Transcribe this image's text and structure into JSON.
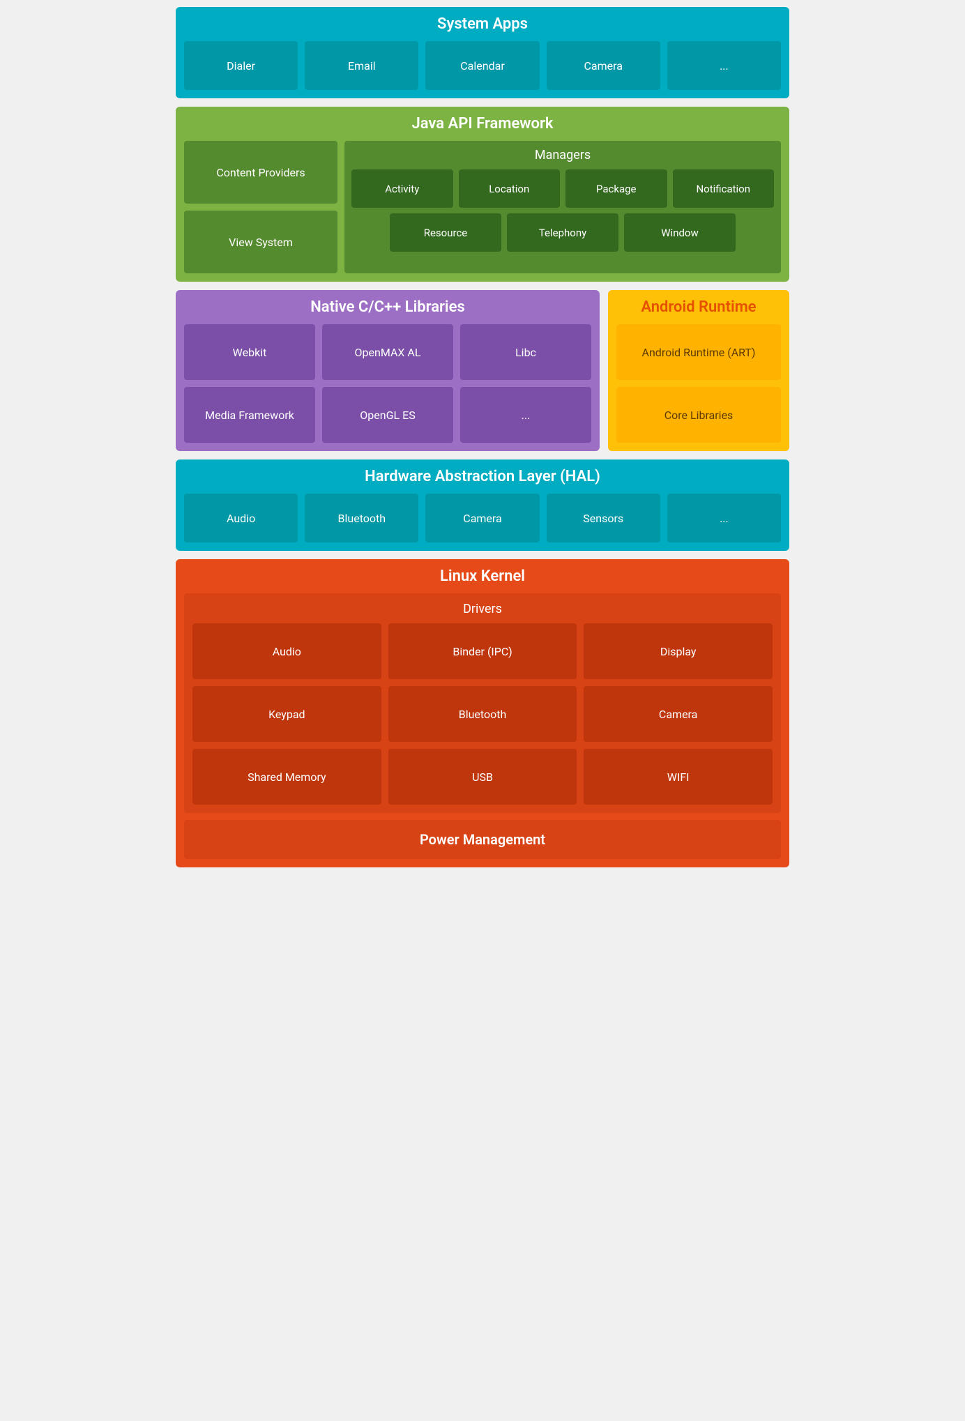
{
  "system_apps": {
    "title": "System Apps",
    "tiles": [
      "Dialer",
      "Email",
      "Calendar",
      "Camera",
      "..."
    ]
  },
  "java_api": {
    "title": "Java API Framework",
    "left_tiles": [
      "Content Providers",
      "View System"
    ],
    "managers_title": "Managers",
    "managers_row1": [
      "Activity",
      "Location",
      "Package",
      "Notification"
    ],
    "managers_row2": [
      "Resource",
      "Telephony",
      "Window"
    ]
  },
  "native_cpp": {
    "title": "Native C/C++ Libraries",
    "tiles": [
      "Webkit",
      "OpenMAX AL",
      "Libc",
      "Media Framework",
      "OpenGL ES",
      "..."
    ]
  },
  "android_runtime": {
    "title": "Android Runtime",
    "tiles": [
      "Android Runtime (ART)",
      "Core Libraries"
    ]
  },
  "hal": {
    "title": "Hardware Abstraction Layer (HAL)",
    "tiles": [
      "Audio",
      "Bluetooth",
      "Camera",
      "Sensors",
      "..."
    ]
  },
  "linux_kernel": {
    "title": "Linux Kernel",
    "drivers_title": "Drivers",
    "drivers": [
      "Audio",
      "Binder (IPC)",
      "Display",
      "Keypad",
      "Bluetooth",
      "Camera",
      "Shared Memory",
      "USB",
      "WIFI"
    ],
    "power_management": "Power Management"
  }
}
